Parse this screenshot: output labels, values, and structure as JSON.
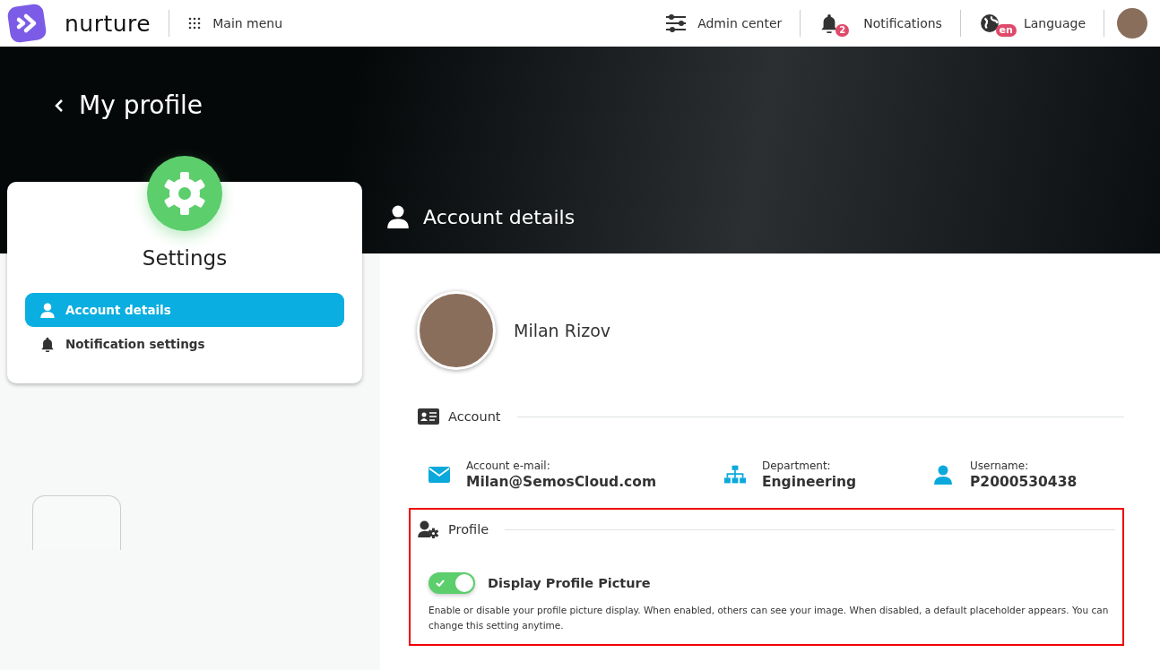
{
  "header": {
    "logo": "nurture",
    "main_menu": "Main menu",
    "admin": "Admin center",
    "notifications": {
      "label": "Notifications",
      "count": "2"
    },
    "language": {
      "label": "Language",
      "badge": "en"
    }
  },
  "page_title": "My profile",
  "sidebar": {
    "title": "Settings",
    "items": [
      {
        "label": "Account details",
        "kind": "user",
        "selected": true
      },
      {
        "label": "Notification settings",
        "kind": "bell",
        "selected": false
      }
    ]
  },
  "section_title": "Account details",
  "profile": {
    "name": "Milan Rizov"
  },
  "account": {
    "title": "Account",
    "fields": [
      {
        "label": "Account e-mail:",
        "value": "Milan@SemosCloud.com",
        "kind": "mail"
      },
      {
        "label": "Department:",
        "value": "Engineering",
        "kind": "org"
      },
      {
        "label": "Username:",
        "value": "P2000530438",
        "kind": "user"
      }
    ]
  },
  "profile_section": {
    "title": "Profile",
    "highlighted": true,
    "toggle": {
      "label": "Display Profile Picture",
      "on": true
    },
    "description": "Enable or disable your profile picture display. When enabled, others can see your image. When disabled, a default placeholder appears. You can change this setting anytime."
  }
}
